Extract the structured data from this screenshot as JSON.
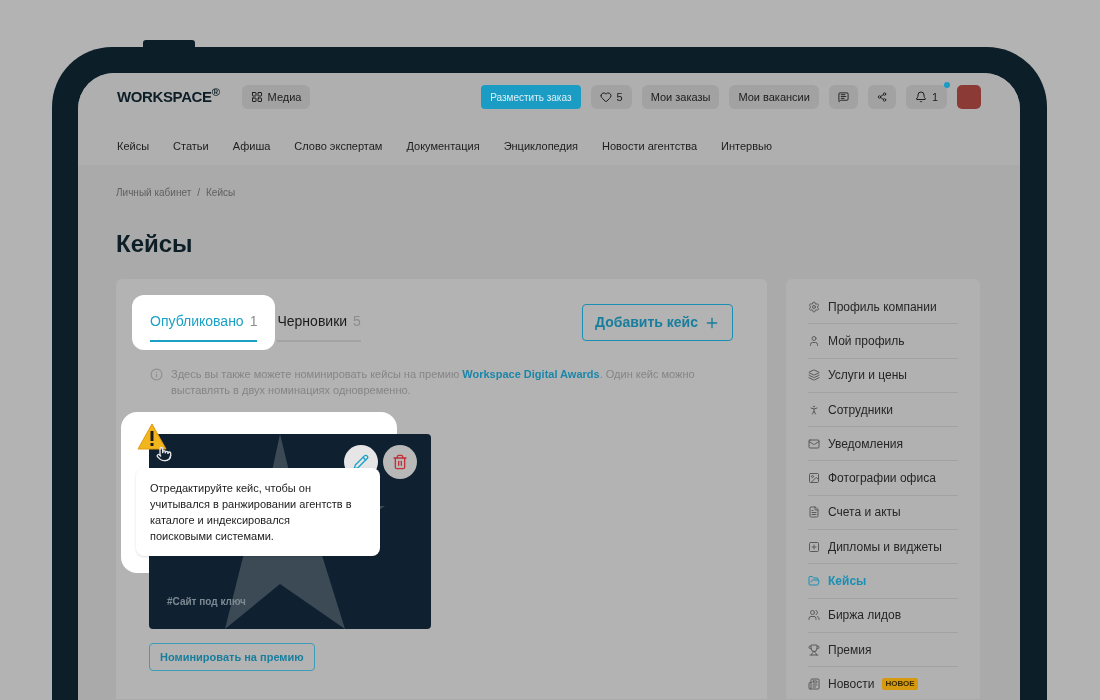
{
  "header": {
    "logo": "WORKSPACE$^{®}$",
    "media_button": "Медиа",
    "order_button": "Разместить заказ",
    "favorites_count": "5",
    "buttons": [
      "Мои заказы",
      "Мои вакансии"
    ],
    "notifications_count": "1"
  },
  "nav": [
    "Кейсы",
    "Статьи",
    "Афиша",
    "Слово экспертам",
    "Документация",
    "Энциклопедия",
    "Новости агентства",
    "Интервью"
  ],
  "breadcrumbs": [
    "Личный кабинет",
    "Кейсы"
  ],
  "breadcrumb_separator": "/",
  "title": "Кейсы",
  "tabs": [
    {
      "label": "Опубликовано",
      "count": "1",
      "selected": true
    },
    {
      "label": "Черновики",
      "count": "5",
      "selected": false
    }
  ],
  "add_button": "Добавить кейс",
  "info": {
    "text_before": "Здесь вы также можете номинировать кейсы на премию",
    "link": "Workspace Digital Awards",
    "text_after": ". Один кейс можно выставлять в двух номинациях одновременно."
  },
  "case_card": {
    "tag": "#Сайт под ключ",
    "tooltip": "Отредактируйте кейс, чтобы он учитывался в ранжировании агентств в каталоге и индексировался поисковыми системами.",
    "nominate_button": "Номинировать на премию"
  },
  "sidebar": [
    {
      "label": "Профиль компании",
      "selected": false
    },
    {
      "label": "Мой профиль",
      "selected": false
    },
    {
      "label": "Услуги и цены",
      "selected": false
    },
    {
      "label": "Сотрудники",
      "selected": false
    },
    {
      "label": "Уведомления",
      "selected": false
    },
    {
      "label": "Фотографии офиса",
      "selected": false
    },
    {
      "label": "Счета и акты",
      "selected": false
    },
    {
      "label": "Дипломы и виджеты",
      "selected": false
    },
    {
      "label": "Кейсы",
      "selected": true
    },
    {
      "label": "Биржа лидов",
      "selected": false
    },
    {
      "label": "Премия",
      "selected": false
    },
    {
      "label": "Новости",
      "selected": false,
      "badge": "НОВОЕ"
    }
  ]
}
